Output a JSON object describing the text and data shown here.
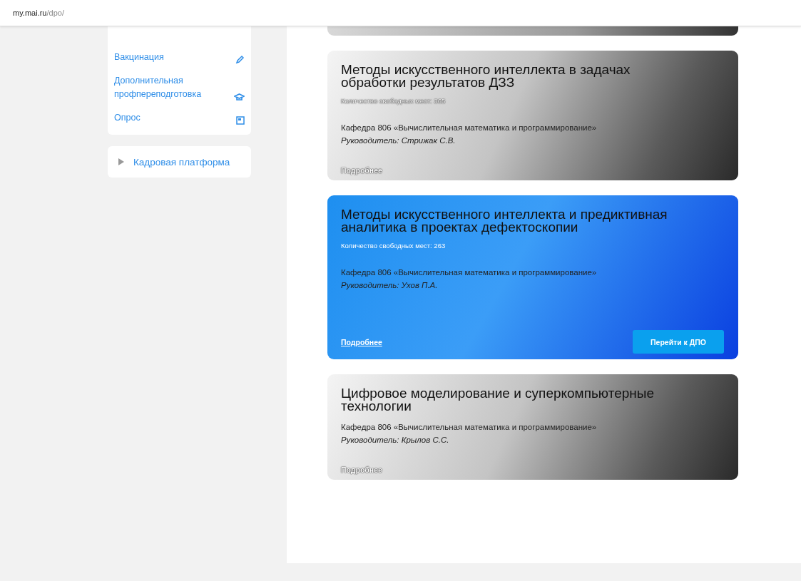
{
  "address_bar": {
    "host": "my.mai.ru",
    "path": "/dpo/"
  },
  "sidebar": {
    "items": [
      {
        "label": "Вакцинация",
        "kind": "vaccine"
      },
      {
        "label": "Дополнительная профпереподготовка",
        "kind": "training"
      },
      {
        "label": "Опрос",
        "kind": "survey"
      }
    ],
    "platform": {
      "label": "Кадровая платформа",
      "expanded": false
    }
  },
  "programs": [
    {
      "kind": "partial"
    },
    {
      "kind": "inactive",
      "title": "Методы искусственного интеллекта в задачах обработки результатов ДЗЗ",
      "seats": "Количество свободных мест: 365",
      "department": "Кафедра 806 «Вычислительная математика и программирование»",
      "head": "Руководитель: Стрижак С.В.",
      "more": "Подробнее"
    },
    {
      "kind": "active",
      "title": "Методы искусственного интеллекта и предиктивная аналитика в проектах дефектоскопии",
      "seats": "Количество свободных мест: 263",
      "department": "Кафедра 806 «Вычислительная математика и программирование»",
      "head": "Руководитель: Ухов П.А.",
      "more": "Подробнее",
      "action": "Перейти к ДПО"
    },
    {
      "kind": "inactive",
      "title": "Цифровое моделирование и суперкомпьютерные технологии",
      "department": "Кафедра 806 «Вычислительная математика и программирование»",
      "head": "Руководитель: Крылов С.С.",
      "more": "Подробнее"
    }
  ]
}
